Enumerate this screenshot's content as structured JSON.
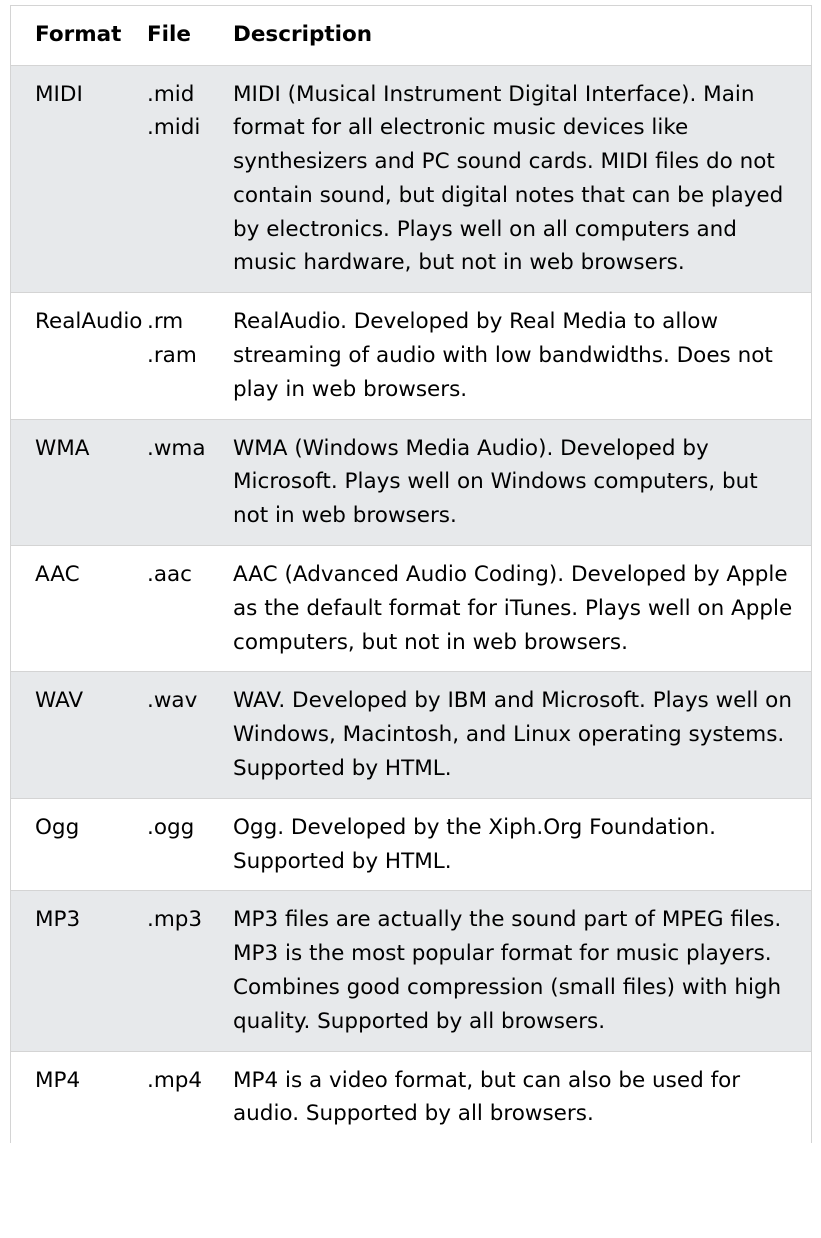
{
  "table": {
    "headers": {
      "format": "Format",
      "file": "File",
      "description": "Description"
    },
    "rows": [
      {
        "format": "MIDI",
        "files": [
          ".mid",
          ".midi"
        ],
        "description": "MIDI (Musical Instrument Digital Interface). Main format for all electronic music devices like synthesizers and PC sound cards. MIDI files do not contain sound, but digital notes that can be played by electronics. Plays well on all computers and music hardware, but not in web browsers."
      },
      {
        "format": "RealAudio",
        "files": [
          ".rm",
          ".ram"
        ],
        "description": "RealAudio. Developed by Real Media to allow streaming of audio with low bandwidths. Does not play in web browsers."
      },
      {
        "format": "WMA",
        "files": [
          ".wma"
        ],
        "description": "WMA (Windows Media Audio). Developed by Microsoft. Plays well on Windows computers, but not in web browsers."
      },
      {
        "format": "AAC",
        "files": [
          ".aac"
        ],
        "description": "AAC (Advanced Audio Coding). Developed by Apple as the default format for iTunes. Plays well on Apple computers, but not in web browsers."
      },
      {
        "format": "WAV",
        "files": [
          ".wav"
        ],
        "description": "WAV. Developed by IBM and Microsoft. Plays well on Windows, Macintosh, and Linux operating systems. Supported by HTML."
      },
      {
        "format": "Ogg",
        "files": [
          ".ogg"
        ],
        "description": "Ogg. Developed by the Xiph.Org Foundation. Supported by HTML."
      },
      {
        "format": "MP3",
        "files": [
          ".mp3"
        ],
        "description": "MP3 files are actually the sound part of MPEG files. MP3 is the most popular format for music players. Combines good compression (small files) with high quality. Supported by all browsers."
      },
      {
        "format": "MP4",
        "files": [
          ".mp4"
        ],
        "description": "MP4 is a video format, but can also be used for audio. Supported by all browsers."
      }
    ]
  },
  "colors": {
    "header_background": "#ffffff",
    "shaded_row": "#e7e9eb",
    "border": "#d4d4d4",
    "text": "#000000"
  }
}
